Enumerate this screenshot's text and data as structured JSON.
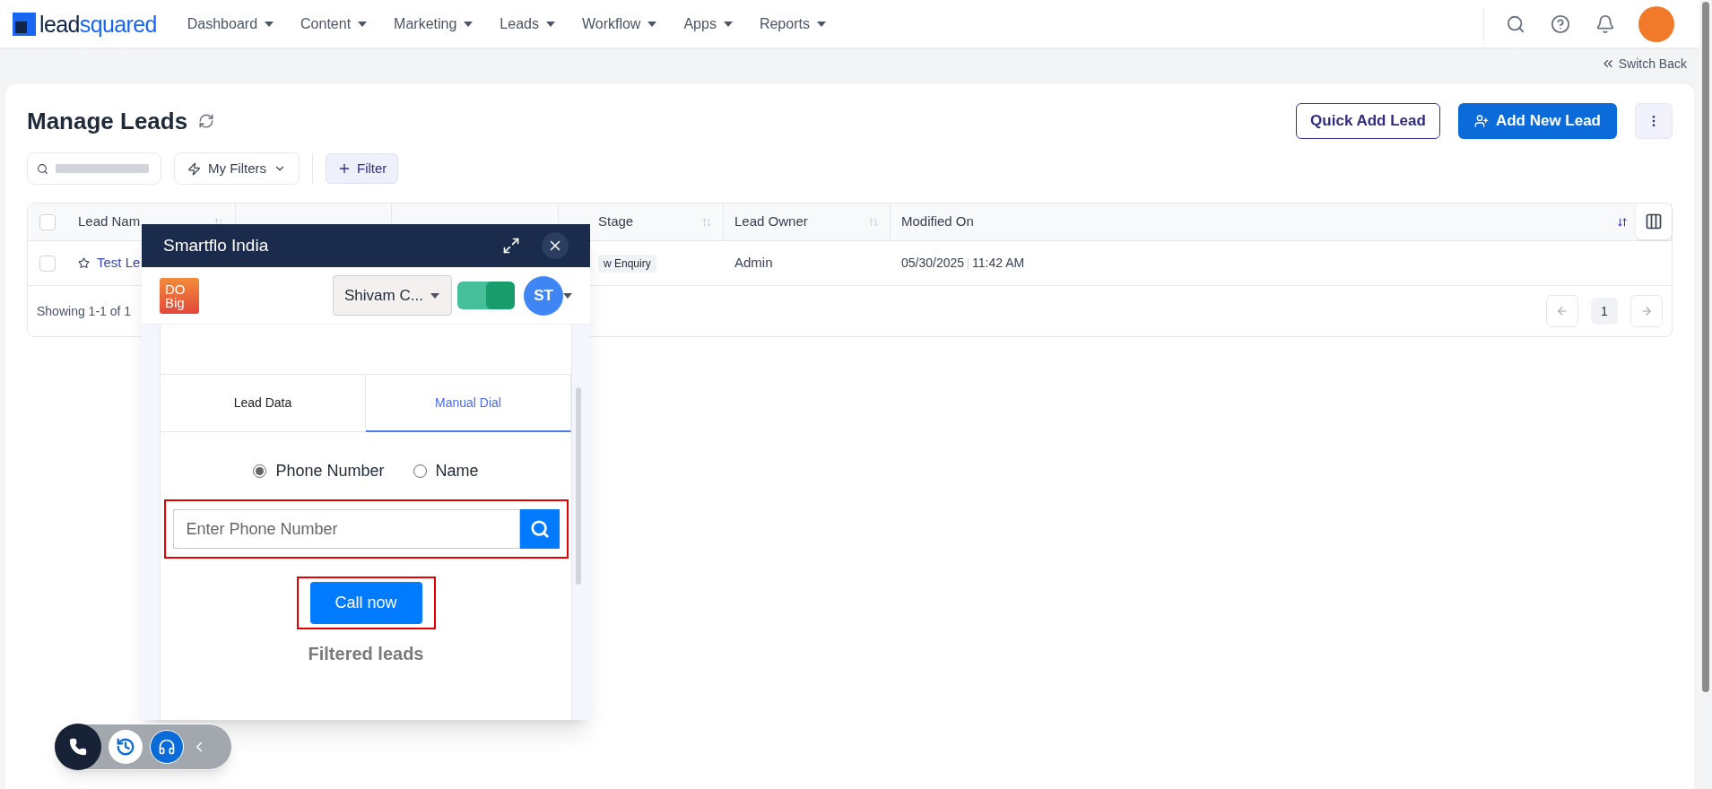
{
  "nav": {
    "logo": [
      "lead",
      "squared"
    ],
    "menus": [
      "Dashboard",
      "Content",
      "Marketing",
      "Leads",
      "Workflow",
      "Apps",
      "Reports"
    ]
  },
  "switch_back": "Switch Back",
  "page": {
    "title": "Manage Leads",
    "quick_add": "Quick Add Lead",
    "add_new": "Add New Lead"
  },
  "toolbar": {
    "my_filters": "My Filters",
    "filter": "Filter"
  },
  "table": {
    "columns": [
      {
        "label": "Lead Nam",
        "sorted": false
      },
      {
        "label": "Stage",
        "sorted": false
      },
      {
        "label": "Lead Owner",
        "sorted": false
      },
      {
        "label": "Modified On",
        "sorted": true
      }
    ],
    "rows": [
      {
        "checked": false,
        "name": "Test Le",
        "stage": "w Enquiry",
        "owner": "Admin",
        "date": "05/30/2025",
        "time": "11:42 AM"
      }
    ],
    "all_checked": false,
    "showing": "Showing 1-1 of 1",
    "page": "1"
  },
  "dialer": {
    "title": "Smartflo India",
    "logo": [
      "DO",
      "Big"
    ],
    "agent": "Shivam C...",
    "online": true,
    "avatar": "ST",
    "tabs": [
      {
        "label": "Lead Data",
        "selected": false
      },
      {
        "label": "Manual Dial",
        "selected": true
      }
    ],
    "search_by": [
      {
        "label": "Phone Number",
        "selected": true
      },
      {
        "label": "Name",
        "selected": false
      }
    ],
    "placeholder": "Enter Phone Number",
    "call": "Call now",
    "filtered": "Filtered leads"
  }
}
